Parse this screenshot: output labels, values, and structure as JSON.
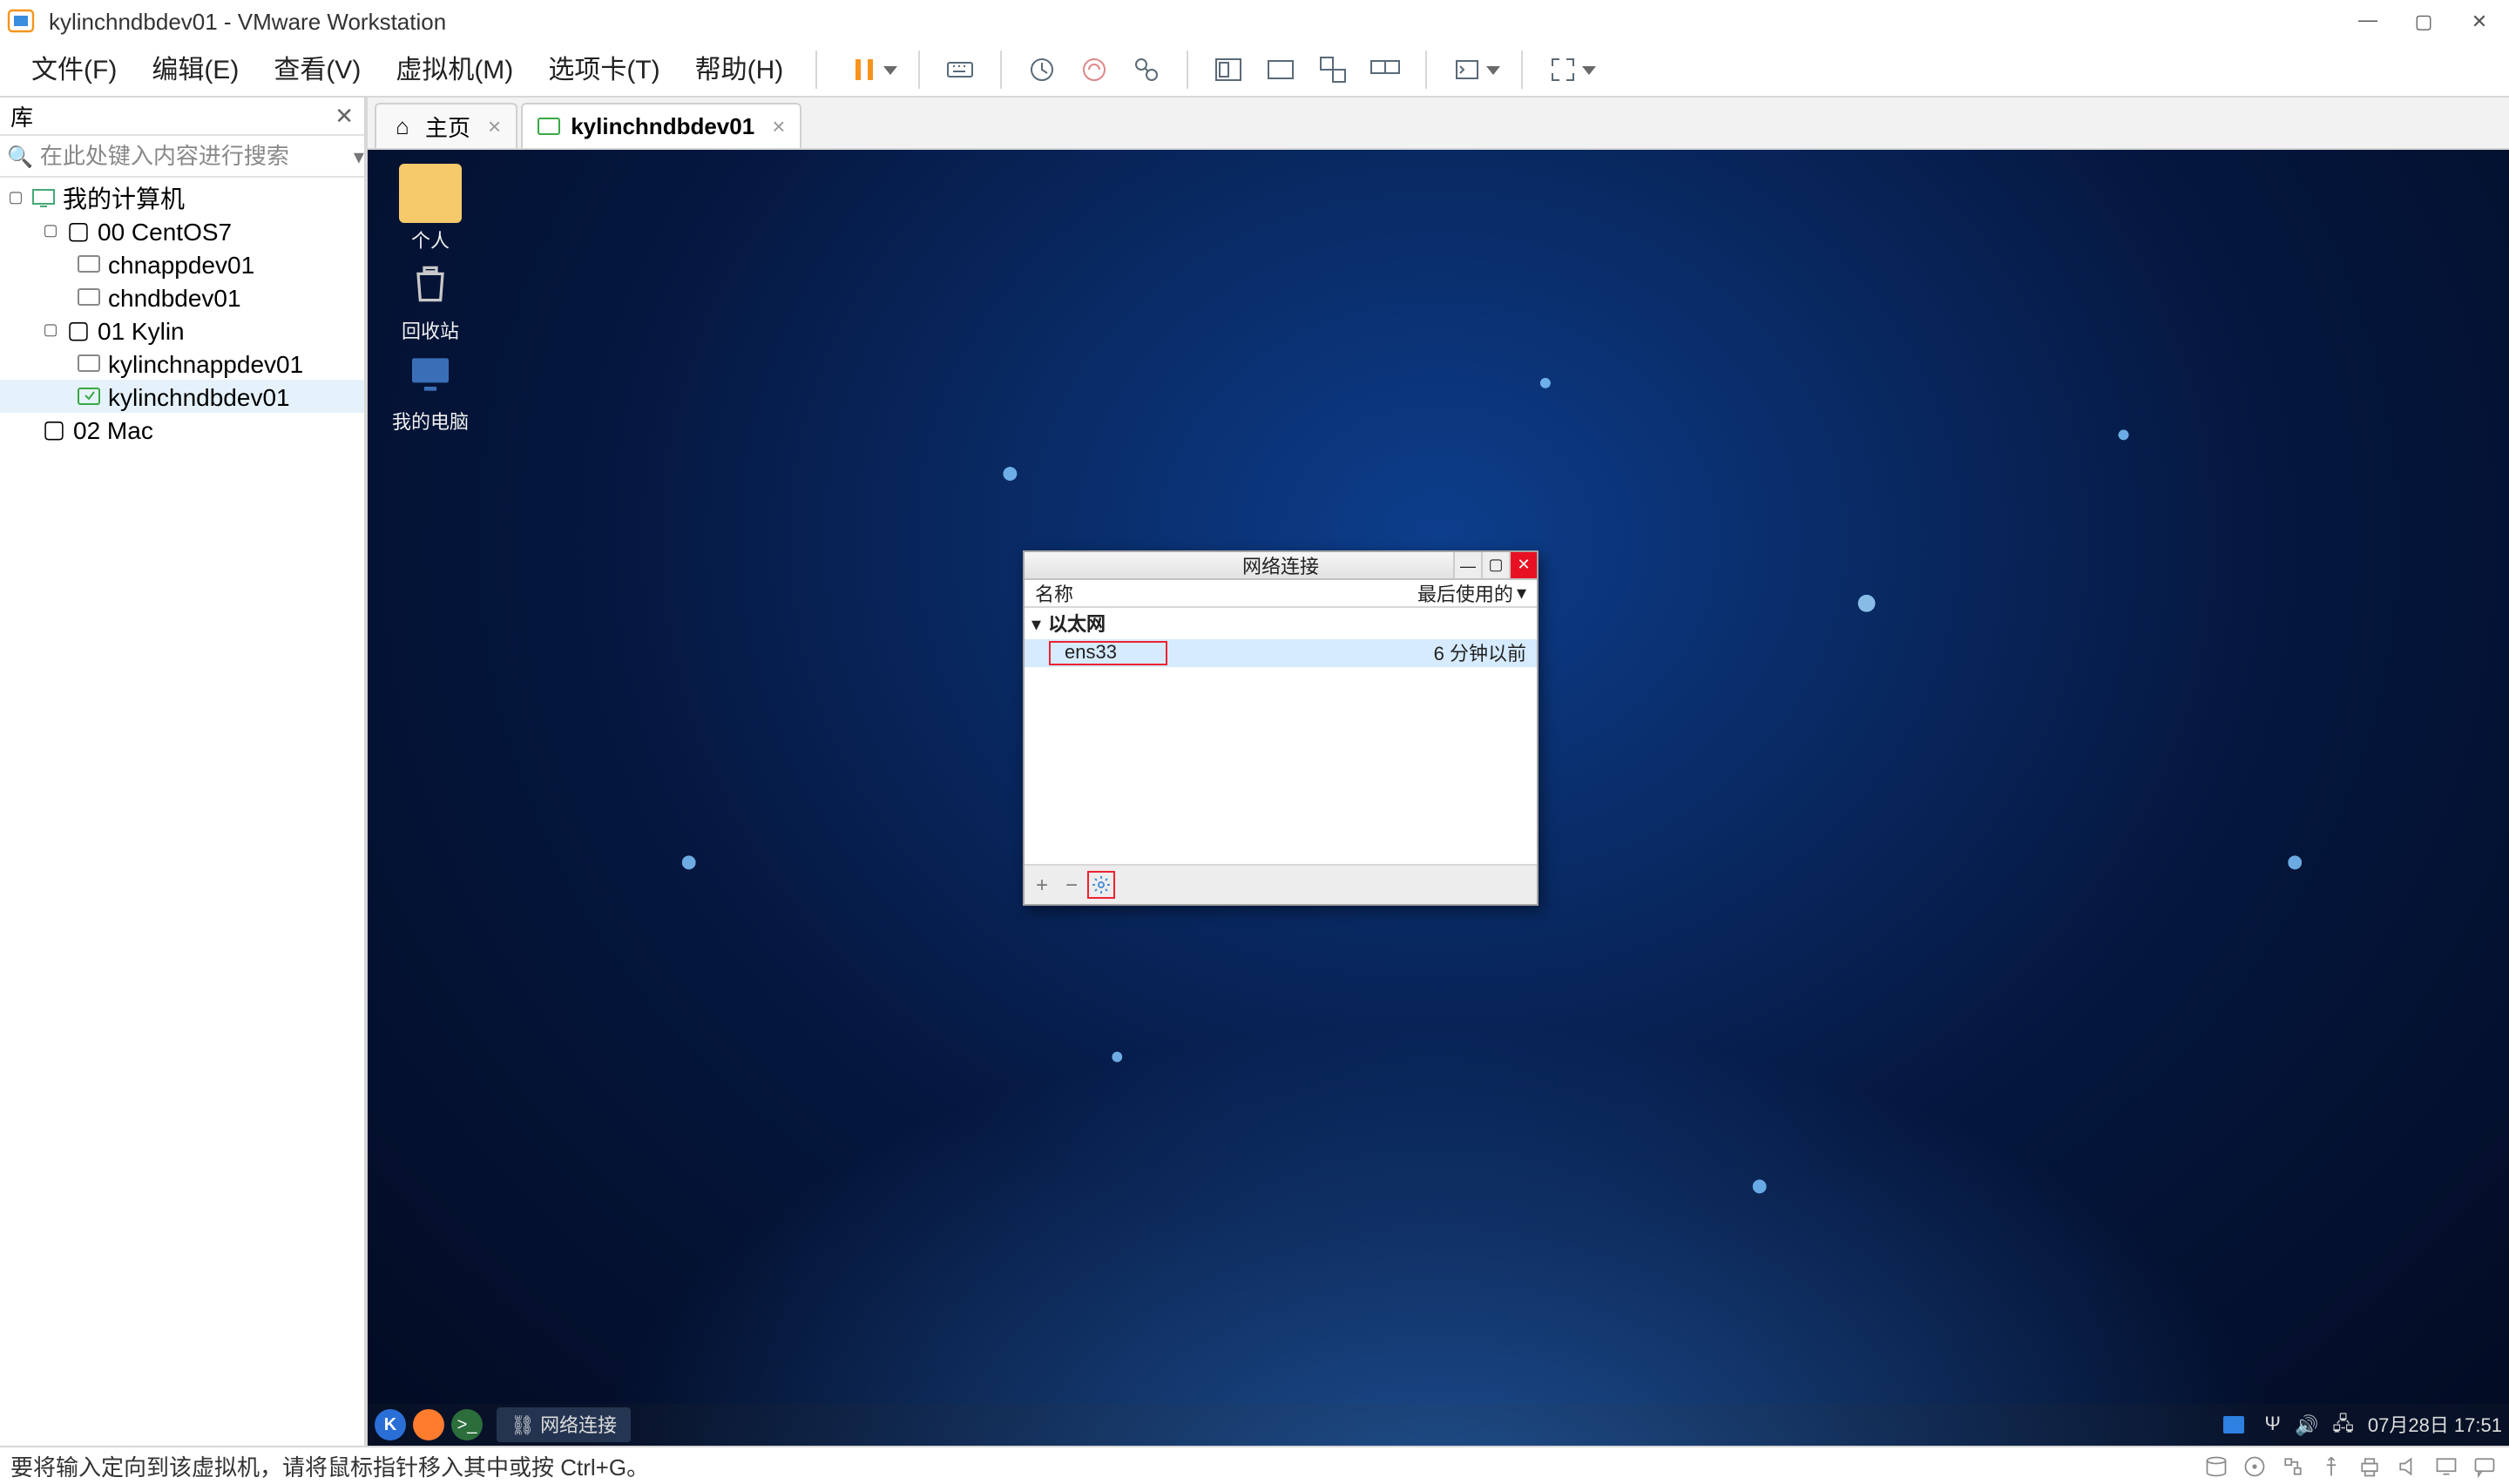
{
  "titlebar": {
    "title": "kylinchndbdev01 - VMware Workstation"
  },
  "menubar": {
    "file": "文件(F)",
    "edit": "编辑(E)",
    "view": "查看(V)",
    "vm": "虚拟机(M)",
    "tabs": "选项卡(T)",
    "help": "帮助(H)"
  },
  "library": {
    "header": "库",
    "search_placeholder": "在此处键入内容进行搜索",
    "tree": {
      "root": "我的计算机",
      "g1": "00 CentOS7",
      "g1a": "chnappdev01",
      "g1b": "chndbdev01",
      "g2": "01 Kylin",
      "g2a": "kylinchnappdev01",
      "g2b": "kylinchndbdev01",
      "g3": "02 Mac"
    }
  },
  "tabs": {
    "home": "主页",
    "vm": "kylinchndbdev01"
  },
  "guest": {
    "icons": {
      "personal": "个人",
      "trash": "回收站",
      "computer": "我的电脑"
    },
    "dialog": {
      "title": "网络连接",
      "col_name": "名称",
      "col_last": "最后使用的",
      "group": "以太网",
      "conn_name": "ens33",
      "conn_time": "6 分钟以前"
    },
    "taskbar": {
      "app": "网络连接",
      "clock": "07月28日 17:51"
    }
  },
  "statusbar": {
    "text": "要将输入定向到该虚拟机，请将鼠标指针移入其中或按 Ctrl+G。"
  }
}
